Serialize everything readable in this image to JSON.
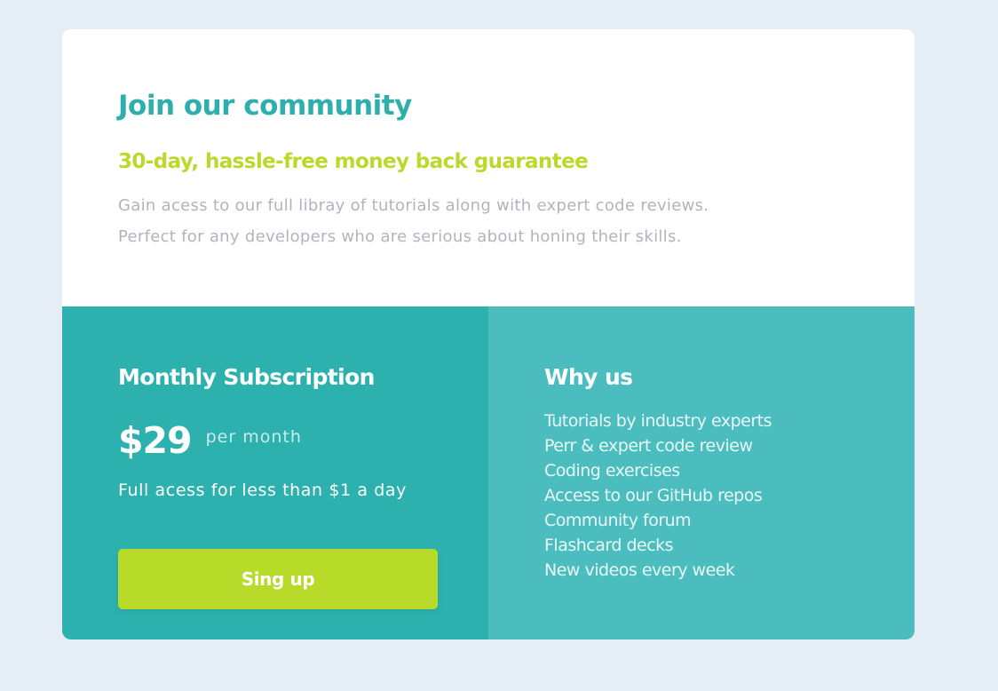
{
  "header": {
    "title": "Join our community",
    "subtitle": "30-day, hassle-free money back guarantee",
    "description_lines": [
      "Gain acess to our full libray of tutorials along with expert code reviews.",
      "Perfect for any developers who are serious about honing their skills."
    ]
  },
  "subscription": {
    "title": "Monthly Subscription",
    "price": "$29",
    "period": "per month",
    "note": "Full acess for less than $1 a day",
    "button_label": "Sing up"
  },
  "why_us": {
    "title": "Why us",
    "items": [
      "Tutorials by industry experts",
      "Perr & expert code review",
      "Coding exercises",
      "Access to our GitHub repos",
      "Community forum",
      "Flashcard decks",
      "New videos every week"
    ]
  },
  "colors": {
    "page_background": "#e5edf6",
    "title": "#2db0ad",
    "subtitle": "#bdd82b",
    "description": "#b3b3bd",
    "left_panel": "#2db1ae",
    "right_panel": "#4bbdbe",
    "button": "#b8da28"
  }
}
